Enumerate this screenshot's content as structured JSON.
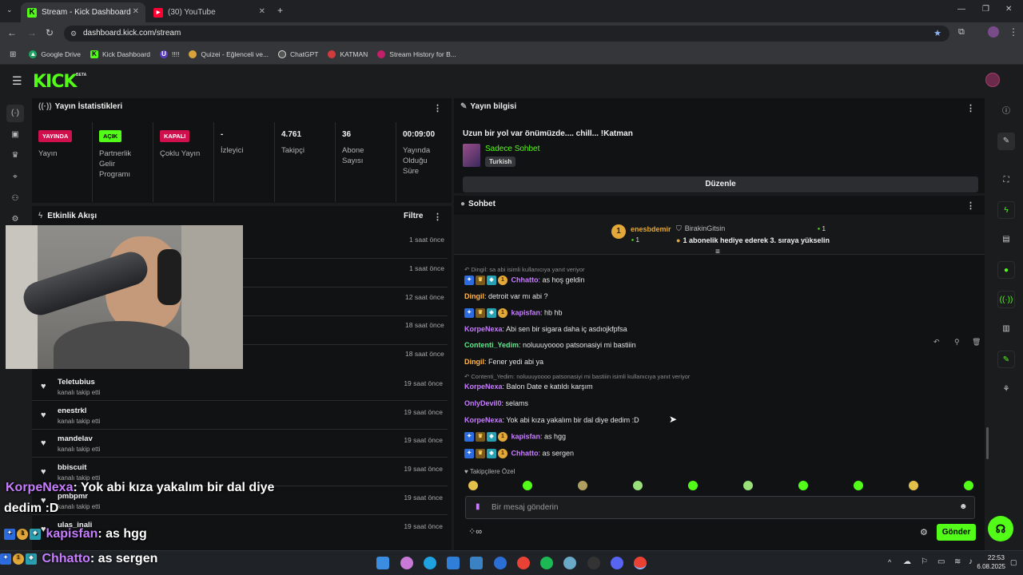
{
  "browser": {
    "tabs": [
      {
        "label": "Stream - Kick Dashboard"
      },
      {
        "label": "(30) YouTube"
      }
    ],
    "url": "dashboard.kick.com/stream",
    "bookmarks": [
      "Google Drive",
      "Kick Dashboard",
      "!!!!",
      "Quizei - Eğlenceli ve...",
      "ChatGPT",
      "KATMAN",
      "Stream History for B..."
    ]
  },
  "kick": {
    "logo": "KICK",
    "beta": "BETA"
  },
  "stats_panel": {
    "title": "Yayın İstatistikleri",
    "stats": [
      {
        "badge": "YAYINDA",
        "label": "Yayın"
      },
      {
        "badge": "AÇIK",
        "label": "Partnerlik Gelir Programı"
      },
      {
        "badge": "KAPALI",
        "label": "Çoklu Yayın"
      },
      {
        "value": "-",
        "label": "İzleyici"
      },
      {
        "value": "4.761",
        "label": "Takipçi"
      },
      {
        "value": "36",
        "label": "Abone Sayısı"
      },
      {
        "value": "00:09:00",
        "label": "Yayında Olduğu Süre"
      }
    ]
  },
  "activity_panel": {
    "title": "Etkinlik Akışı",
    "filter": "Filtre",
    "hidden_times": [
      "1 saat önce",
      "1 saat önce",
      "12 saat önce",
      "18 saat önce",
      "18 saat önce"
    ],
    "items": [
      {
        "name": "Teletubius",
        "action": "kanalı takip etti",
        "time": "19 saat önce"
      },
      {
        "name": "enestrkl",
        "action": "kanalı takip etti",
        "time": "19 saat önce"
      },
      {
        "name": "mandelav",
        "action": "kanalı takip etti",
        "time": "19 saat önce"
      },
      {
        "name": "bbiscuit",
        "action": "kanalı takip etti",
        "time": "19 saat önce"
      },
      {
        "name": "pmbpmr",
        "action": "kanalı takip etti",
        "time": "19 saat önce"
      },
      {
        "name": "ulas_inali",
        "action": "",
        "time": "19 saat önce"
      }
    ]
  },
  "stream_info": {
    "title_label": "Yayın bilgisi",
    "stream_title": "Uzun bir yol var önümüzde.... chill... !Katman",
    "category": "Sadece Sohbet",
    "language": "Turkish",
    "edit_button": "Düzenle"
  },
  "chat": {
    "title": "Sohbet",
    "pinned": {
      "gifter": "enesbdemir",
      "gifter_count": "1",
      "recipient": "BirakinGitsin",
      "recipient_count": "1",
      "text": "1 abonelik hediye ederek 3. sıraya yükselin",
      "rank": "1"
    },
    "messages": [
      {
        "reply": "Dingil: sa abi isimli kullanıcıya yanıt veriyor",
        "user": "Chhatto",
        "text": ": as hoş geldin",
        "color": "#c77dff",
        "badges": true
      },
      {
        "user": "Dingil",
        "text": ": detroit var mı abi ?",
        "color": "#ffb74d",
        "badges": false
      },
      {
        "user": "kapisfan",
        "text": ": hb hb",
        "color": "#c77dff",
        "badges": true
      },
      {
        "user": "KorpeNexa",
        "text": ": Abi sen bir sigara daha iç asdıojkfpfsa",
        "color": "#c77dff",
        "badges": false
      },
      {
        "user": "Contenti_Yedim",
        "text": ": noluuuyoooo patsonasiyi mi bastiiin",
        "color": "#5eea8c",
        "badges": false
      },
      {
        "user": "Dingil",
        "text": ": Fener yedi abi ya",
        "color": "#ffb74d",
        "badges": false
      },
      {
        "reply": "Contenti_Yedim: noluuuyoooo patsonasiyi mi bastiiin isimli kullanıcıya yanıt veriyor",
        "user": "KorpeNexa",
        "text": ": Balon Date e katıldı karşım",
        "color": "#c77dff",
        "badges": false
      },
      {
        "user": "OnlyDevil0",
        "text": ": selams",
        "color": "#c77dff",
        "badges": false
      },
      {
        "user": "KorpeNexa",
        "text": ": Yok abi kıza yakalım bir dal diye dedim :D",
        "color": "#c77dff",
        "badges": false
      },
      {
        "user": "kapisfan",
        "text": ": as hgg",
        "color": "#c77dff",
        "badges": true
      },
      {
        "user": "Chhatto",
        "text": ": as sergen",
        "color": "#c77dff",
        "badges": true
      }
    ],
    "emote_label": "Takipçilere Özel",
    "input_placeholder": "Bir mesaj gönderin",
    "send_button": "Gönder"
  },
  "overlay": {
    "line1_user": "KorpeNexa",
    "line1_text": ": Yok abi kıza yakalım bir dal diye",
    "line1b_text": "dedim :D",
    "line2_user": "kapisfan",
    "line2_text": ": as hgg",
    "line3_user": "Chhatto",
    "line3_text": ": as sergen"
  },
  "taskbar": {
    "time": "22:53",
    "date": "6.08.2025"
  },
  "colors": {
    "kick_green": "#53fc18",
    "live_red": "#d0104c",
    "purple_user": "#c77dff"
  }
}
